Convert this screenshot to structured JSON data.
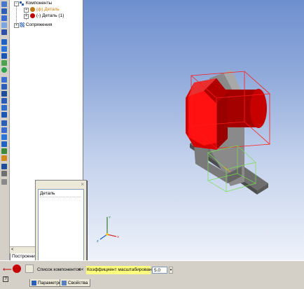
{
  "tree": {
    "components_label": "Компоненты",
    "part_fixed_label": "(ф) Деталь",
    "part_free_label": "(-) Деталь (1)",
    "mates_label": "Сопряжения"
  },
  "tree_tab": {
    "label": "Построение"
  },
  "component_popup": {
    "close_glyph": "×",
    "items": [
      "Деталь"
    ]
  },
  "property_bar": {
    "component_list_label": "Список компонентов",
    "collapse_glyph": "<<",
    "scale_label": "Коэффициент масштабирования, %",
    "scale_value": "5.0",
    "tab_parameters": "Параметры",
    "tab_properties": "Свойства"
  },
  "colors": {
    "selection_box": "#ff1a1a",
    "ghost_box": "#77dd55",
    "part_red": "#d30000",
    "part_gray": "#8a8a8a",
    "highlight": "#ffff80"
  },
  "axis_labels": {
    "x": "X",
    "y": "Y",
    "z": "Z"
  }
}
